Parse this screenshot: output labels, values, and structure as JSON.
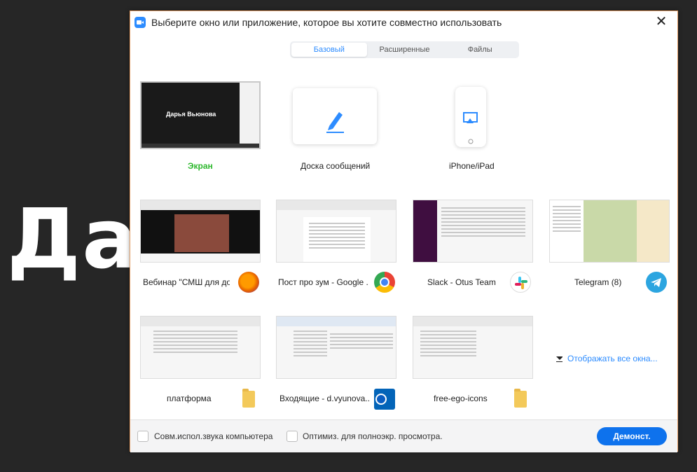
{
  "background": {
    "text": "Дар"
  },
  "dialog": {
    "title": "Выберите окно или приложение, которое вы хотите совместно использовать",
    "close_icon": "close-icon"
  },
  "tabs": [
    {
      "label": "Базовый",
      "active": true
    },
    {
      "label": "Расширенные",
      "active": false
    },
    {
      "label": "Файлы",
      "active": false
    }
  ],
  "row1": [
    {
      "label": "Экран",
      "thumb_text": "Дарья Вьюнова",
      "selected": true
    },
    {
      "label": "Доска сообщений",
      "icon": "pencil-icon"
    },
    {
      "label": "iPhone/iPad",
      "icon": "phone-airplay-icon"
    }
  ],
  "windows": [
    {
      "label": "Вебинар \"СМШ для до...",
      "app_icon": "firefox-icon"
    },
    {
      "label": "Пост про зум - Google ...",
      "app_icon": "chrome-icon"
    },
    {
      "label": "Slack - Otus Team",
      "app_icon": "slack-icon"
    },
    {
      "label": "Telegram (8)",
      "app_icon": "telegram-icon"
    },
    {
      "label": "платформа",
      "app_icon": "folder-icon"
    },
    {
      "label": "Входящие - d.vyunova...",
      "app_icon": "outlook-icon"
    },
    {
      "label": "free-ego-icons",
      "app_icon": "folder-icon"
    }
  ],
  "show_all": "Отображать все окна...",
  "footer": {
    "sound_label": "Совм.испол.звука компьютера",
    "optimize_label": "Оптимиз. для полноэкр. просмотра.",
    "share_button": "Демонст."
  },
  "colors": {
    "accent": "#0e72ed",
    "selected_label": "#2eb82e",
    "link": "#2d8cff"
  }
}
